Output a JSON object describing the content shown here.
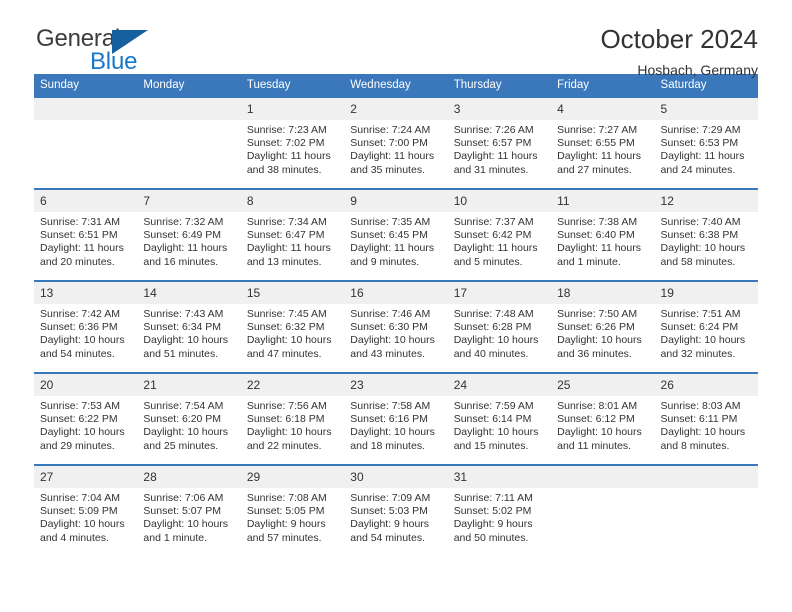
{
  "brand": {
    "name_part1": "General",
    "name_part2": "Blue",
    "triangle_icon": "blue-triangle-icon",
    "color_dark": "#3c3c3c",
    "color_blue": "#1878c8",
    "color_triangle": "#17609f"
  },
  "header": {
    "month_title": "October 2024",
    "location": "Hosbach, Germany"
  },
  "theme": {
    "header_blue": "#3a77bb",
    "row_divider": "#3a77bb",
    "daynum_band": "#f0f0f0",
    "text": "#333333"
  },
  "calendar": {
    "weekday_headers": [
      "Sunday",
      "Monday",
      "Tuesday",
      "Wednesday",
      "Thursday",
      "Friday",
      "Saturday"
    ],
    "weeks": [
      [
        {
          "day": "",
          "empty": true,
          "sunrise": "",
          "sunset": "",
          "daylight_line1": "",
          "daylight_line2": ""
        },
        {
          "day": "",
          "empty": true,
          "sunrise": "",
          "sunset": "",
          "daylight_line1": "",
          "daylight_line2": ""
        },
        {
          "day": "1",
          "empty": false,
          "sunrise": "Sunrise: 7:23 AM",
          "sunset": "Sunset: 7:02 PM",
          "daylight_line1": "Daylight: 11 hours",
          "daylight_line2": "and 38 minutes."
        },
        {
          "day": "2",
          "empty": false,
          "sunrise": "Sunrise: 7:24 AM",
          "sunset": "Sunset: 7:00 PM",
          "daylight_line1": "Daylight: 11 hours",
          "daylight_line2": "and 35 minutes."
        },
        {
          "day": "3",
          "empty": false,
          "sunrise": "Sunrise: 7:26 AM",
          "sunset": "Sunset: 6:57 PM",
          "daylight_line1": "Daylight: 11 hours",
          "daylight_line2": "and 31 minutes."
        },
        {
          "day": "4",
          "empty": false,
          "sunrise": "Sunrise: 7:27 AM",
          "sunset": "Sunset: 6:55 PM",
          "daylight_line1": "Daylight: 11 hours",
          "daylight_line2": "and 27 minutes."
        },
        {
          "day": "5",
          "empty": false,
          "sunrise": "Sunrise: 7:29 AM",
          "sunset": "Sunset: 6:53 PM",
          "daylight_line1": "Daylight: 11 hours",
          "daylight_line2": "and 24 minutes."
        }
      ],
      [
        {
          "day": "6",
          "empty": false,
          "sunrise": "Sunrise: 7:31 AM",
          "sunset": "Sunset: 6:51 PM",
          "daylight_line1": "Daylight: 11 hours",
          "daylight_line2": "and 20 minutes."
        },
        {
          "day": "7",
          "empty": false,
          "sunrise": "Sunrise: 7:32 AM",
          "sunset": "Sunset: 6:49 PM",
          "daylight_line1": "Daylight: 11 hours",
          "daylight_line2": "and 16 minutes."
        },
        {
          "day": "8",
          "empty": false,
          "sunrise": "Sunrise: 7:34 AM",
          "sunset": "Sunset: 6:47 PM",
          "daylight_line1": "Daylight: 11 hours",
          "daylight_line2": "and 13 minutes."
        },
        {
          "day": "9",
          "empty": false,
          "sunrise": "Sunrise: 7:35 AM",
          "sunset": "Sunset: 6:45 PM",
          "daylight_line1": "Daylight: 11 hours",
          "daylight_line2": "and 9 minutes."
        },
        {
          "day": "10",
          "empty": false,
          "sunrise": "Sunrise: 7:37 AM",
          "sunset": "Sunset: 6:42 PM",
          "daylight_line1": "Daylight: 11 hours",
          "daylight_line2": "and 5 minutes."
        },
        {
          "day": "11",
          "empty": false,
          "sunrise": "Sunrise: 7:38 AM",
          "sunset": "Sunset: 6:40 PM",
          "daylight_line1": "Daylight: 11 hours",
          "daylight_line2": "and 1 minute."
        },
        {
          "day": "12",
          "empty": false,
          "sunrise": "Sunrise: 7:40 AM",
          "sunset": "Sunset: 6:38 PM",
          "daylight_line1": "Daylight: 10 hours",
          "daylight_line2": "and 58 minutes."
        }
      ],
      [
        {
          "day": "13",
          "empty": false,
          "sunrise": "Sunrise: 7:42 AM",
          "sunset": "Sunset: 6:36 PM",
          "daylight_line1": "Daylight: 10 hours",
          "daylight_line2": "and 54 minutes."
        },
        {
          "day": "14",
          "empty": false,
          "sunrise": "Sunrise: 7:43 AM",
          "sunset": "Sunset: 6:34 PM",
          "daylight_line1": "Daylight: 10 hours",
          "daylight_line2": "and 51 minutes."
        },
        {
          "day": "15",
          "empty": false,
          "sunrise": "Sunrise: 7:45 AM",
          "sunset": "Sunset: 6:32 PM",
          "daylight_line1": "Daylight: 10 hours",
          "daylight_line2": "and 47 minutes."
        },
        {
          "day": "16",
          "empty": false,
          "sunrise": "Sunrise: 7:46 AM",
          "sunset": "Sunset: 6:30 PM",
          "daylight_line1": "Daylight: 10 hours",
          "daylight_line2": "and 43 minutes."
        },
        {
          "day": "17",
          "empty": false,
          "sunrise": "Sunrise: 7:48 AM",
          "sunset": "Sunset: 6:28 PM",
          "daylight_line1": "Daylight: 10 hours",
          "daylight_line2": "and 40 minutes."
        },
        {
          "day": "18",
          "empty": false,
          "sunrise": "Sunrise: 7:50 AM",
          "sunset": "Sunset: 6:26 PM",
          "daylight_line1": "Daylight: 10 hours",
          "daylight_line2": "and 36 minutes."
        },
        {
          "day": "19",
          "empty": false,
          "sunrise": "Sunrise: 7:51 AM",
          "sunset": "Sunset: 6:24 PM",
          "daylight_line1": "Daylight: 10 hours",
          "daylight_line2": "and 32 minutes."
        }
      ],
      [
        {
          "day": "20",
          "empty": false,
          "sunrise": "Sunrise: 7:53 AM",
          "sunset": "Sunset: 6:22 PM",
          "daylight_line1": "Daylight: 10 hours",
          "daylight_line2": "and 29 minutes."
        },
        {
          "day": "21",
          "empty": false,
          "sunrise": "Sunrise: 7:54 AM",
          "sunset": "Sunset: 6:20 PM",
          "daylight_line1": "Daylight: 10 hours",
          "daylight_line2": "and 25 minutes."
        },
        {
          "day": "22",
          "empty": false,
          "sunrise": "Sunrise: 7:56 AM",
          "sunset": "Sunset: 6:18 PM",
          "daylight_line1": "Daylight: 10 hours",
          "daylight_line2": "and 22 minutes."
        },
        {
          "day": "23",
          "empty": false,
          "sunrise": "Sunrise: 7:58 AM",
          "sunset": "Sunset: 6:16 PM",
          "daylight_line1": "Daylight: 10 hours",
          "daylight_line2": "and 18 minutes."
        },
        {
          "day": "24",
          "empty": false,
          "sunrise": "Sunrise: 7:59 AM",
          "sunset": "Sunset: 6:14 PM",
          "daylight_line1": "Daylight: 10 hours",
          "daylight_line2": "and 15 minutes."
        },
        {
          "day": "25",
          "empty": false,
          "sunrise": "Sunrise: 8:01 AM",
          "sunset": "Sunset: 6:12 PM",
          "daylight_line1": "Daylight: 10 hours",
          "daylight_line2": "and 11 minutes."
        },
        {
          "day": "26",
          "empty": false,
          "sunrise": "Sunrise: 8:03 AM",
          "sunset": "Sunset: 6:11 PM",
          "daylight_line1": "Daylight: 10 hours",
          "daylight_line2": "and 8 minutes."
        }
      ],
      [
        {
          "day": "27",
          "empty": false,
          "sunrise": "Sunrise: 7:04 AM",
          "sunset": "Sunset: 5:09 PM",
          "daylight_line1": "Daylight: 10 hours",
          "daylight_line2": "and 4 minutes."
        },
        {
          "day": "28",
          "empty": false,
          "sunrise": "Sunrise: 7:06 AM",
          "sunset": "Sunset: 5:07 PM",
          "daylight_line1": "Daylight: 10 hours",
          "daylight_line2": "and 1 minute."
        },
        {
          "day": "29",
          "empty": false,
          "sunrise": "Sunrise: 7:08 AM",
          "sunset": "Sunset: 5:05 PM",
          "daylight_line1": "Daylight: 9 hours",
          "daylight_line2": "and 57 minutes."
        },
        {
          "day": "30",
          "empty": false,
          "sunrise": "Sunrise: 7:09 AM",
          "sunset": "Sunset: 5:03 PM",
          "daylight_line1": "Daylight: 9 hours",
          "daylight_line2": "and 54 minutes."
        },
        {
          "day": "31",
          "empty": false,
          "sunrise": "Sunrise: 7:11 AM",
          "sunset": "Sunset: 5:02 PM",
          "daylight_line1": "Daylight: 9 hours",
          "daylight_line2": "and 50 minutes."
        },
        {
          "day": "",
          "empty": true,
          "sunrise": "",
          "sunset": "",
          "daylight_line1": "",
          "daylight_line2": ""
        },
        {
          "day": "",
          "empty": true,
          "sunrise": "",
          "sunset": "",
          "daylight_line1": "",
          "daylight_line2": ""
        }
      ]
    ]
  }
}
